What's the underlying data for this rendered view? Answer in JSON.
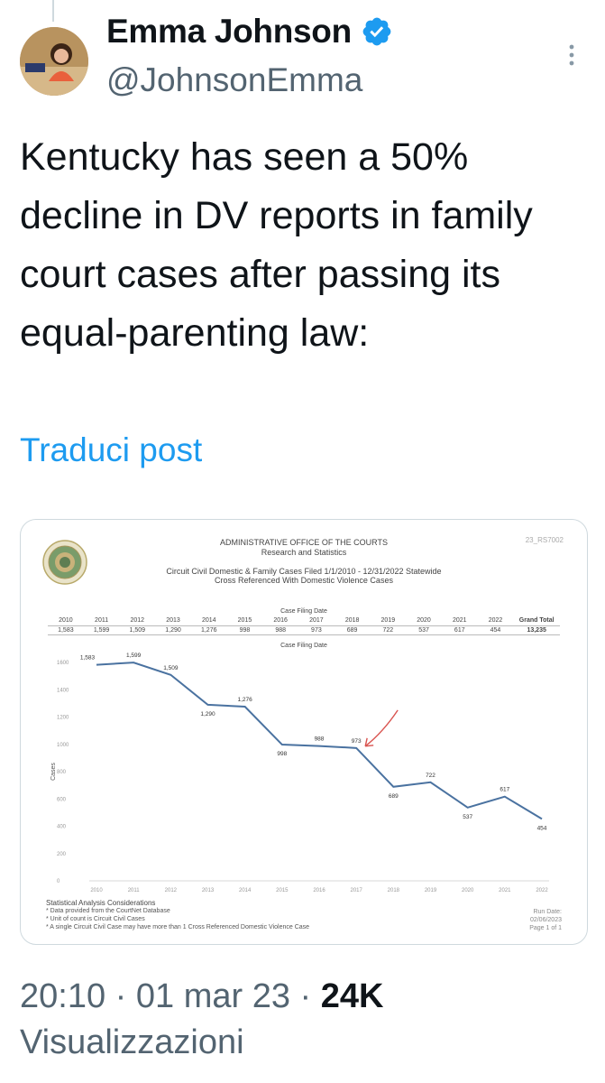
{
  "author": {
    "name": "Emma Johnson",
    "handle": "@JohnsonEmma"
  },
  "tweet": {
    "text": "Kentucky has seen a 50% decline in DV reports in family court cases after passing its equal-parenting law:",
    "translate_label": "Traduci post"
  },
  "meta": {
    "time": "20:10",
    "date": "01 mar 23",
    "views": "24K",
    "views_label": "Visualizzazioni"
  },
  "document": {
    "code": "23_RS7002",
    "header1": "ADMINISTRATIVE OFFICE OF THE COURTS",
    "header2": "Research and Statistics",
    "header3": "Circuit Civil Domestic & Family Cases Filed 1/1/2010 - 12/31/2022 Statewide",
    "header4": "Cross Referenced With Domestic Violence Cases",
    "table_title": "Case Filing Date",
    "chart_title": "Case Filing Date",
    "grand_total_label": "Grand Total",
    "grand_total": "13,235",
    "footer_title": "Statistical Analysis Considerations",
    "footer_notes": [
      "* Data provided from the CourtNet Database",
      "* Unit of count is Circuit Civil Cases",
      "* A single Circuit Civil Case may have more than 1 Cross Referenced Domestic Violence Case"
    ],
    "run_date_label": "Run Date:",
    "run_date": "02/06/2023",
    "page": "Page 1 of 1"
  },
  "chart_data": {
    "type": "line",
    "x": [
      "2010",
      "2011",
      "2012",
      "2013",
      "2014",
      "2015",
      "2016",
      "2017",
      "2018",
      "2019",
      "2020",
      "2021",
      "2022"
    ],
    "series": [
      {
        "values": [
          1583,
          1599,
          1509,
          1290,
          1276,
          998,
          988,
          973,
          689,
          722,
          537,
          617,
          454
        ],
        "labels": [
          "1,583",
          "1,599",
          "1,509",
          "1,290",
          "1,276",
          "998",
          "988",
          "973",
          "689",
          "722",
          "537",
          "617",
          "454"
        ]
      }
    ],
    "ylabel": "Cases",
    "xlabel": "",
    "ylim": [
      0,
      1600
    ],
    "yticks": [
      0,
      200,
      400,
      600,
      800,
      1000,
      1200,
      1400,
      1600
    ],
    "grid": false,
    "line_color": "#4a72a0",
    "annotation": {
      "type": "arrow",
      "target_index": 7,
      "color": "#d9534f"
    }
  }
}
